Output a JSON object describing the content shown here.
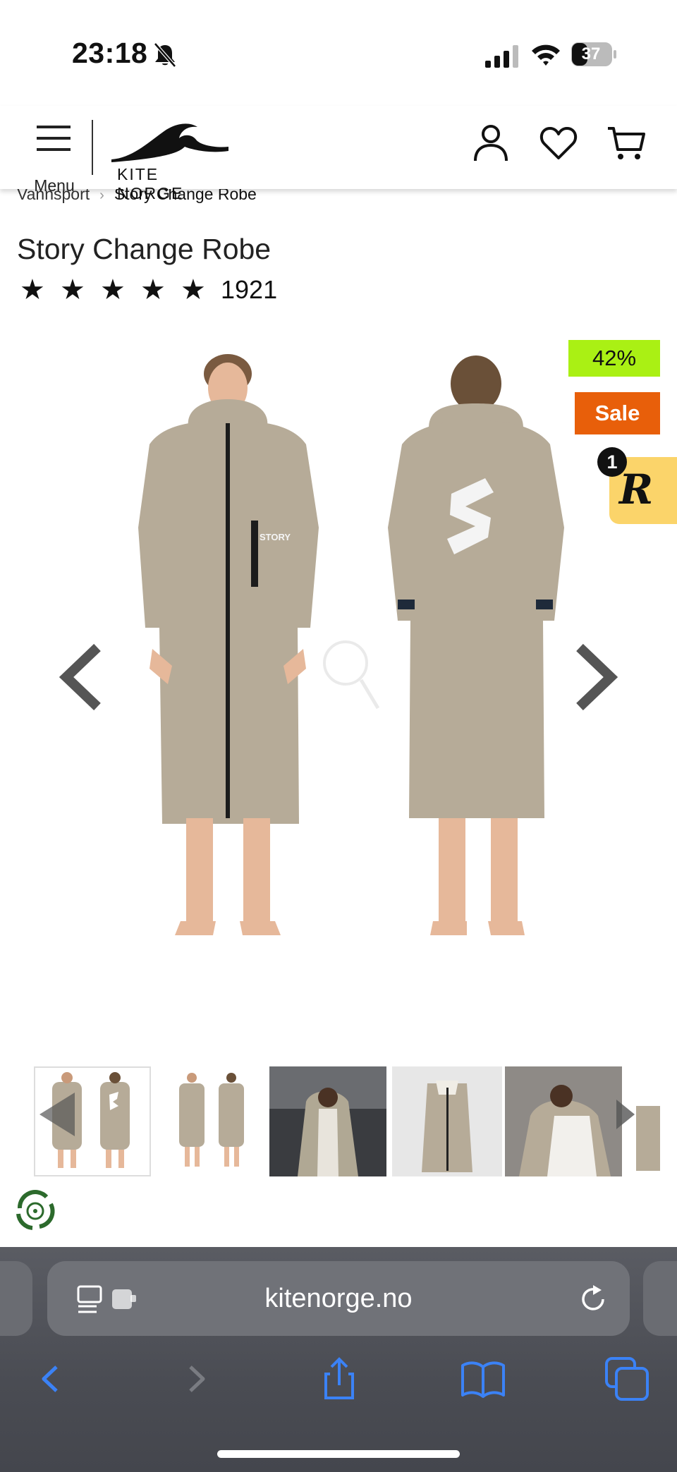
{
  "status_bar": {
    "time": "23:18",
    "battery_level": "37",
    "icons": [
      "bell-muted-icon",
      "cellular-signal-icon",
      "wifi-icon",
      "battery-icon"
    ]
  },
  "header": {
    "menu_label": "Menu",
    "logo_text": "KITE NORGE",
    "icons": [
      "account-icon",
      "wishlist-heart-icon",
      "cart-icon"
    ]
  },
  "breadcrumb": {
    "parent": "Vannsport",
    "current": "Story Change Robe"
  },
  "product": {
    "title": "Story Change Robe",
    "rating_stars": 5,
    "review_count": "1921",
    "discount_badge": "42%",
    "sale_badge": "Sale",
    "image_brand_text": "STORY",
    "image_logo_letter": "S",
    "colors": {
      "robe": "#b6ab98",
      "discount": "#aaf014",
      "sale": "#e85f0a"
    }
  },
  "rewards_widget": {
    "letter": "R",
    "notification_count": "1"
  },
  "thumbnails": {
    "count": 6,
    "active_index": 0
  },
  "browser": {
    "url": "kitenorge.no",
    "toolbar": [
      "back-icon",
      "forward-icon",
      "share-icon",
      "bookmarks-icon",
      "tabs-icon"
    ]
  }
}
